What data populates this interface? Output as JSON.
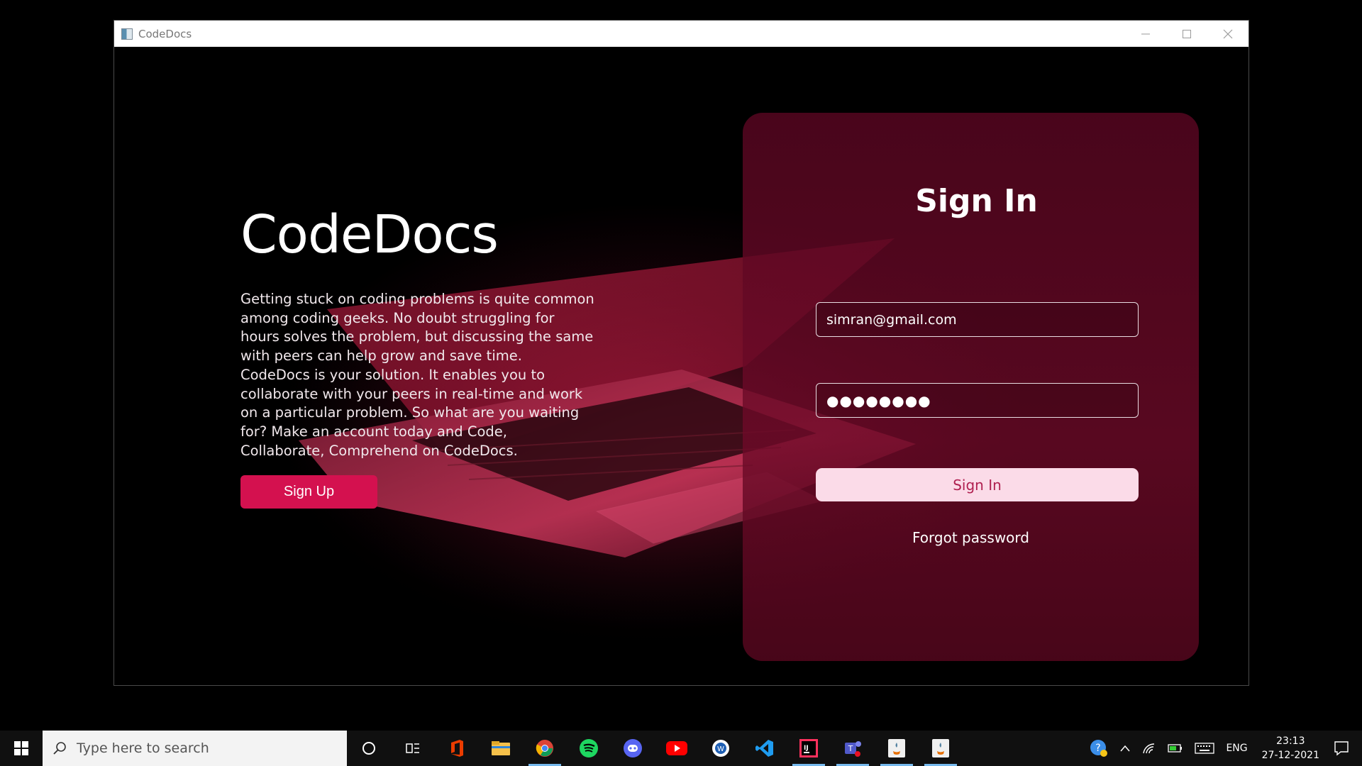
{
  "window": {
    "title": "CodeDocs"
  },
  "hero": {
    "brand": "CodeDocs",
    "description": "Getting stuck on coding problems is quite common among coding geeks. No doubt struggling for hours solves the problem, but discussing the same with peers can help grow and save time. CodeDocs is your solution. It enables you to collaborate with your peers in real-time and work on a particular problem. So what are you waiting for? Make an account today and Code, Collaborate, Comprehend on CodeDocs.",
    "signup_label": "Sign Up"
  },
  "signin": {
    "title": "Sign In",
    "email_value": "simran@gmail.com",
    "password_value": "●●●●●●●●",
    "button_label": "Sign In",
    "forgot_label": "Forgot password"
  },
  "taskbar": {
    "search_placeholder": "Type here to search",
    "apps": [
      "cortana-icon",
      "task-view-icon",
      "office-icon",
      "file-explorer-icon",
      "chrome-icon",
      "spotify-icon",
      "discord-icon",
      "youtube-icon",
      "word-icon",
      "vscode-icon",
      "intellij-icon",
      "teams-icon",
      "java-icon",
      "java-icon"
    ],
    "language": "ENG",
    "time": "23:13",
    "date": "27-12-2021"
  },
  "colors": {
    "accent": "#d4114f",
    "card": "#5a0620",
    "signin_button": "#fbdbe8"
  }
}
